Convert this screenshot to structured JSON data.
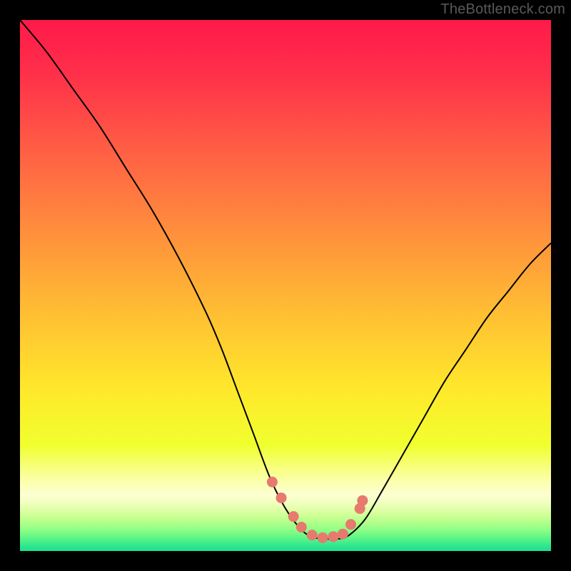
{
  "watermark": "TheBottleneck.com",
  "colors": {
    "frame": "#000000",
    "curve": "#000000",
    "marker_fill": "#e7796f",
    "marker_stroke": "#e7796f",
    "gradient_stops": [
      {
        "offset": 0.0,
        "color": "#ff1a49"
      },
      {
        "offset": 0.1,
        "color": "#ff2f4a"
      },
      {
        "offset": 0.25,
        "color": "#ff6044"
      },
      {
        "offset": 0.4,
        "color": "#ff8f3c"
      },
      {
        "offset": 0.55,
        "color": "#ffbe33"
      },
      {
        "offset": 0.7,
        "color": "#ffe92b"
      },
      {
        "offset": 0.8,
        "color": "#f0ff2e"
      },
      {
        "offset": 0.865,
        "color": "#fbffa7"
      },
      {
        "offset": 0.895,
        "color": "#fcffd2"
      },
      {
        "offset": 0.912,
        "color": "#eeffba"
      },
      {
        "offset": 0.928,
        "color": "#d7ff9c"
      },
      {
        "offset": 0.944,
        "color": "#b7ff8b"
      },
      {
        "offset": 0.96,
        "color": "#8fff86"
      },
      {
        "offset": 0.976,
        "color": "#5bf587"
      },
      {
        "offset": 0.992,
        "color": "#2be58e"
      },
      {
        "offset": 1.0,
        "color": "#1de091"
      }
    ]
  },
  "chart_data": {
    "type": "line",
    "title": "",
    "xlabel": "",
    "ylabel": "",
    "xlim": [
      0,
      100
    ],
    "ylim": [
      0,
      100
    ],
    "series": [
      {
        "name": "bottleneck-curve",
        "x": [
          0,
          5,
          10,
          15,
          20,
          25,
          30,
          35,
          38,
          41,
          44,
          47,
          50,
          53,
          55,
          57,
          60,
          62,
          65,
          68,
          72,
          76,
          80,
          84,
          88,
          92,
          96,
          100
        ],
        "y": [
          100,
          94,
          87,
          80,
          72,
          64,
          55,
          45,
          38,
          30,
          22,
          14,
          8,
          4,
          2.7,
          2.3,
          2.3,
          3.0,
          6,
          11,
          18,
          25,
          32,
          38,
          44,
          49,
          54,
          58
        ]
      }
    ],
    "markers": {
      "name": "highlight-points",
      "x": [
        47.5,
        49.2,
        51.5,
        53.0,
        55.0,
        57.0,
        59.0,
        60.8,
        62.3,
        64.0,
        64.5
      ],
      "y": [
        13.0,
        10.0,
        6.5,
        4.5,
        3.0,
        2.5,
        2.7,
        3.2,
        5.0,
        8.0,
        9.5
      ]
    }
  }
}
